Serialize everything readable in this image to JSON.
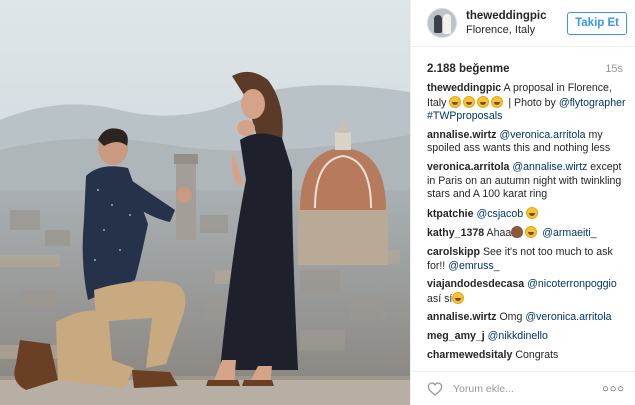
{
  "post": {
    "image_alt": "Man kneeling proposing to a woman on a terrace overlooking Florence",
    "author": {
      "username": "theweddingpic",
      "location": "Florence, Italy"
    },
    "follow_label": "Takip Et",
    "likes": "2.188 beğenme",
    "time": "15s",
    "caption": {
      "user": "theweddingpic",
      "text_a": "A proposal in Florence, Italy",
      "text_b": "| Photo by",
      "photo_credit": "@flytographer",
      "hashtag": "#TWPproposals"
    },
    "comments": [
      {
        "user": "annalise.wirtz",
        "mention": "@veronica.arritola",
        "text": "my spoiled ass wants this and nothing less"
      },
      {
        "user": "veronica.arritola",
        "mention": "@annalise.wirtz",
        "text": "except in Paris on an autumn night with twinkling stars and A 100 karat ring"
      },
      {
        "user": "ktpatchie",
        "mention": "@csjacob",
        "text": ""
      },
      {
        "user": "kathy_1378",
        "text": "Ahaa",
        "mention": "@armaeiti_"
      },
      {
        "user": "carolskipp",
        "text": "See it's not too much to ask for!!",
        "mention": "@emruss_"
      },
      {
        "user": "viajandodesdecasa",
        "mention": "@nicoterronpoggio",
        "text": "así sí"
      },
      {
        "user": "annalise.wirtz",
        "text": "Omg",
        "mention": "@veronica.arritola"
      },
      {
        "user": "meg_amy_j",
        "mention": "@nikkdinello",
        "text": ""
      },
      {
        "user": "charmewedsitaly",
        "text": "Congrats"
      }
    ],
    "comment_placeholder": "Yorum ekle...",
    "more_label": "○○○"
  },
  "icons": {
    "heart": "heart-outline-icon",
    "emoji": "heart-eyes-emoji"
  },
  "colors": {
    "link": "#003569",
    "follow": "#3897f0",
    "muted": "#999999",
    "text": "#262626"
  }
}
